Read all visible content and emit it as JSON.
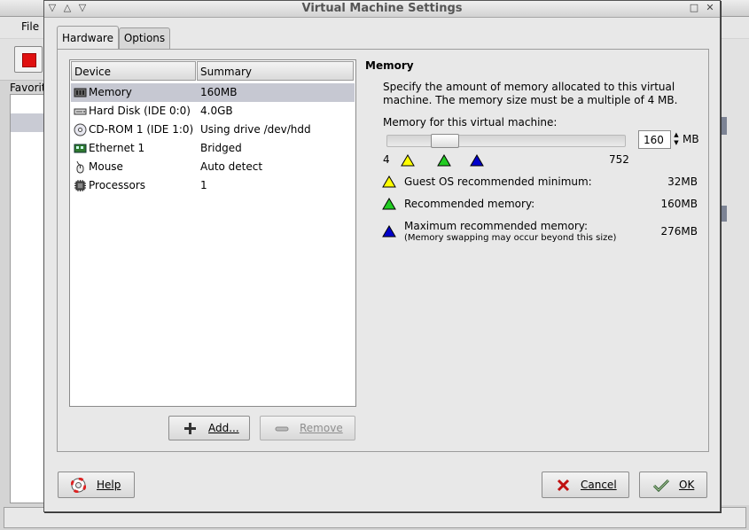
{
  "background_app": {
    "menu_file": "File",
    "favorites_label": "Favorit"
  },
  "dialog": {
    "title": "Virtual Machine Settings",
    "tabs": [
      {
        "label": "Hardware",
        "active": true
      },
      {
        "label": "Options",
        "active": false
      }
    ],
    "device_table": {
      "columns": [
        "Device",
        "Summary"
      ],
      "rows": [
        {
          "device": "Memory",
          "summary": "160MB",
          "icon": "memory-icon",
          "selected": true
        },
        {
          "device": "Hard Disk (IDE 0:0)",
          "summary": "4.0GB",
          "icon": "hard-disk-icon",
          "selected": false
        },
        {
          "device": "CD-ROM 1 (IDE 1:0)",
          "summary": "Using drive /dev/hdd",
          "icon": "cdrom-icon",
          "selected": false
        },
        {
          "device": "Ethernet 1",
          "summary": "Bridged",
          "icon": "ethernet-icon",
          "selected": false
        },
        {
          "device": "Mouse",
          "summary": "Auto detect",
          "icon": "mouse-icon",
          "selected": false
        },
        {
          "device": "Processors",
          "summary": "1",
          "icon": "processor-icon",
          "selected": false
        }
      ]
    },
    "buttons": {
      "add": "Add...",
      "remove": "Remove",
      "help": "Help",
      "cancel": "Cancel",
      "ok": "OK"
    },
    "memory": {
      "heading": "Memory",
      "description": "Specify the amount of memory allocated to this virtual machine. The memory size must be a multiple of 4 MB.",
      "for_vm_label": "Memory for this virtual machine:",
      "value": "160",
      "unit": "MB",
      "slider": {
        "min": 4,
        "max": 752,
        "current": 160,
        "min_label": "4",
        "max_label": "752"
      },
      "legend": [
        {
          "label": "Guest OS recommended minimum:",
          "value": "32MB",
          "color": "#ffff00"
        },
        {
          "label": "Recommended memory:",
          "value": "160MB",
          "color": "#22cc22"
        },
        {
          "label": "Maximum recommended memory:",
          "value": "276MB",
          "color": "#0000cc",
          "note": "(Memory swapping may occur beyond this size)"
        }
      ]
    }
  }
}
